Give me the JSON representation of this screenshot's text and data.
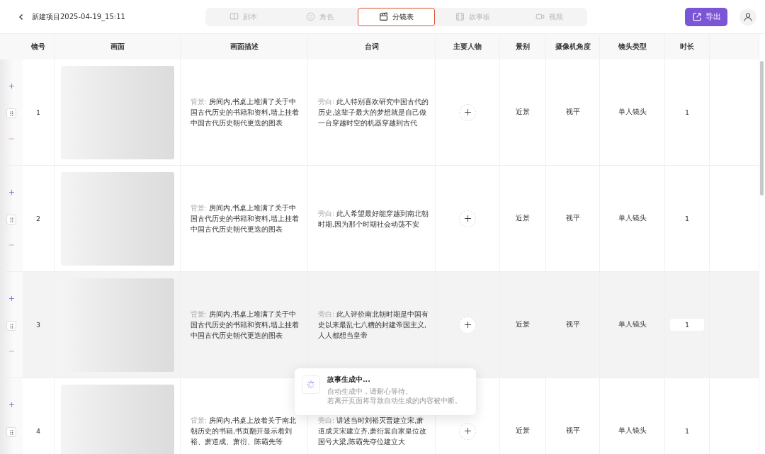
{
  "header": {
    "title": "新建项目2025-04-19_15:11",
    "export_label": "导出"
  },
  "tabs": [
    {
      "label": "剧本",
      "selected": false
    },
    {
      "label": "角色",
      "selected": false
    },
    {
      "label": "分镜表",
      "selected": true
    },
    {
      "label": "故事板",
      "selected": false
    },
    {
      "label": "视频",
      "selected": false
    }
  ],
  "table": {
    "columns": [
      "镜号",
      "画面",
      "画面描述",
      "台词",
      "主要人物",
      "景别",
      "摄像机角度",
      "镜头类型",
      "时长"
    ],
    "rows": [
      {
        "number": "1",
        "highlighted": false,
        "desc_label": "背景:",
        "description": "房间内,书桌上堆满了关于中国古代历史的书籍和资料,墙上挂着中国古代历史朝代更迭的图表",
        "line_label": "旁白:",
        "line": "此人特别喜欢研究中国古代的历史,这辈子最大的梦想就是自己做一台穿越时空的机器穿越到古代",
        "shot_size": "近景",
        "camera_angle": "视平",
        "shot_type": "单人镜头",
        "duration": "1"
      },
      {
        "number": "2",
        "highlighted": false,
        "desc_label": "背景:",
        "description": "房间内,书桌上堆满了关于中国古代历史的书籍和资料,墙上挂着中国古代历史朝代更迭的图表",
        "line_label": "旁白:",
        "line": "此人希望最好能穿越到南北朝时期,因为那个时期社会动荡不安",
        "shot_size": "近景",
        "camera_angle": "视平",
        "shot_type": "单人镜头",
        "duration": "1"
      },
      {
        "number": "3",
        "highlighted": true,
        "desc_label": "背景:",
        "description": "房间内,书桌上堆满了关于中国古代历史的书籍和资料,墙上挂着中国古代历史朝代更迭的图表",
        "line_label": "旁白:",
        "line": "此人评价南北朝时期是中国有史以来最乱七八糟的封建帝国主义,人人都想当皇帝",
        "shot_size": "近景",
        "camera_angle": "视平",
        "shot_type": "单人镜头",
        "duration": "1"
      },
      {
        "number": "4",
        "highlighted": false,
        "desc_label": "背景:",
        "description": "房间内,书桌上放着关于南北朝历史的书籍,书页翻开显示着刘裕、萧道成、萧衍、陈霸先等",
        "line_label": "旁白:",
        "line": "讲述当时刘裕灭晋建立宋,萧道成灭宋建立齐,萧衍篡自家皇位改国号大梁,陈霸先夺位建立大",
        "shot_size": "近景",
        "camera_angle": "视平",
        "shot_type": "单人镜头",
        "duration": "1"
      }
    ]
  },
  "toast": {
    "title": "故事生成中...",
    "lines": [
      "自动生成中，请耐心等待。",
      "若离开页面将导致自动生成的内容被中断。"
    ]
  }
}
